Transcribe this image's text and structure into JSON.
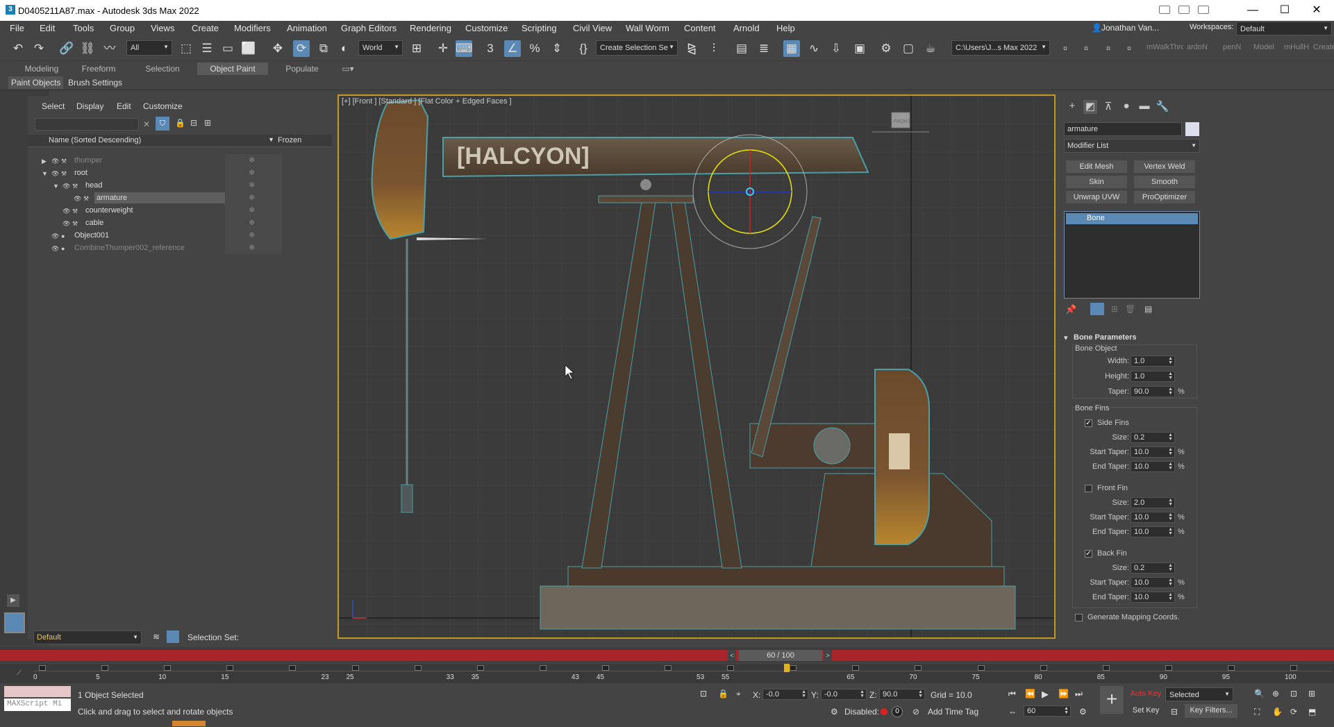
{
  "window": {
    "title": "D0405211A87.max - Autodesk 3ds Max 2022",
    "app_icon": "3",
    "minimize": "—",
    "maximize": "☐",
    "close": "✕"
  },
  "menu": [
    "File",
    "Edit",
    "Tools",
    "Group",
    "Views",
    "Create",
    "Modifiers",
    "Animation",
    "Graph Editors",
    "Rendering",
    "Customize",
    "Scripting",
    "Civil View",
    "Wall Worm",
    "Content",
    "Arnold",
    "Help"
  ],
  "account": {
    "user": "Jonathan Van...",
    "workspaces_label": "Workspaces:",
    "workspace": "Default"
  },
  "toolbar": {
    "filter": "All",
    "coord_system": "World",
    "selection_set": "Create Selection Se",
    "project_path": "C:\\Users\\J...s Max 2022",
    "plugins": [
      "mWalkThro",
      "ardoN",
      "penN",
      "Model",
      "mHullH",
      "Create"
    ]
  },
  "ribbon": {
    "tabs": [
      "Modeling",
      "Freeform",
      "Selection",
      "Object Paint",
      "Populate"
    ],
    "active": "Object Paint",
    "subtabs": [
      "Paint Objects",
      "Brush Settings"
    ]
  },
  "scene_explorer": {
    "menu": [
      "Select",
      "Display",
      "Edit",
      "Customize"
    ],
    "column_name": "Name (Sorted Descending)",
    "column_frozen": "Frozen",
    "rows": [
      {
        "name": "thumper",
        "indent": 0,
        "expander": "▶",
        "dim": true
      },
      {
        "name": "root",
        "indent": 0,
        "expander": "▼",
        "dim": false
      },
      {
        "name": "head",
        "indent": 1,
        "expander": "▼",
        "dim": false
      },
      {
        "name": "armature",
        "indent": 2,
        "expander": "",
        "dim": false,
        "selected": true
      },
      {
        "name": "counterweight",
        "indent": 1,
        "expander": "",
        "dim": false
      },
      {
        "name": "cable",
        "indent": 1,
        "expander": "",
        "dim": false
      },
      {
        "name": "Object001",
        "indent": 0,
        "expander": "",
        "dim": false
      },
      {
        "name": "CombineThumper002_reference",
        "indent": 0,
        "expander": "",
        "dim": true
      }
    ],
    "layer": "Default",
    "selection_set_label": "Selection Set:"
  },
  "viewport": {
    "label": "[+] [Front ] [Standard ] [Flat Color + Edged Faces ]",
    "sign_text": "[HALCYON]",
    "viewcube": "FRONT"
  },
  "command_panel": {
    "object_name": "armature",
    "modifier_list": "Modifier List",
    "buttons": [
      "Edit Mesh",
      "Vertex Weld",
      "Skin",
      "Smooth",
      "Unwrap UVW",
      "ProOptimizer"
    ],
    "stack": [
      "Bone"
    ],
    "rollout": "Bone Parameters",
    "bone_object_label": "Bone Object",
    "width": {
      "label": "Width:",
      "value": "1.0"
    },
    "height": {
      "label": "Height:",
      "value": "1.0"
    },
    "taper": {
      "label": "Taper:",
      "value": "90.0",
      "unit": "%"
    },
    "bone_fins_label": "Bone Fins",
    "side_fins": {
      "label": "Side Fins",
      "checked": true,
      "size": "0.2",
      "start_taper": "10.0",
      "end_taper": "10.0"
    },
    "front_fin": {
      "label": "Front Fin",
      "checked": false,
      "size": "2.0",
      "start_taper": "10.0",
      "end_taper": "10.0"
    },
    "back_fin": {
      "label": "Back Fin",
      "checked": true,
      "size": "0.2",
      "start_taper": "10.0",
      "end_taper": "10.0"
    },
    "size_label": "Size:",
    "start_taper_label": "Start Taper:",
    "end_taper_label": "End Taper:",
    "pct": "%",
    "generate_mapping": "Generate Mapping Coords."
  },
  "timeline": {
    "frame": "60 / 100",
    "ticks": [
      "0",
      "5",
      "10",
      "15",
      "23",
      "25",
      "33",
      "35",
      "43",
      "45",
      "53",
      "55",
      "65",
      "70",
      "75",
      "80",
      "85",
      "90",
      "95",
      "100"
    ],
    "current_marker": "60"
  },
  "status": {
    "maxscript": "MAXScript Mi",
    "selected": "1 Object Selected",
    "prompt": "Click and drag to select and rotate objects",
    "x_label": "X:",
    "x": "-0.0",
    "y_label": "Y:",
    "y": "-0.0",
    "z_label": "Z:",
    "z": "90.0",
    "grid": "Grid = 10.0",
    "disabled_label": "Disabled:",
    "disabled_value": "0",
    "add_time_tag": "Add Time Tag",
    "auto_key": "Auto Key",
    "set_key": "Set Key",
    "key_mode": "Selected",
    "key_filters": "Key Filters...",
    "current_frame": "60"
  }
}
